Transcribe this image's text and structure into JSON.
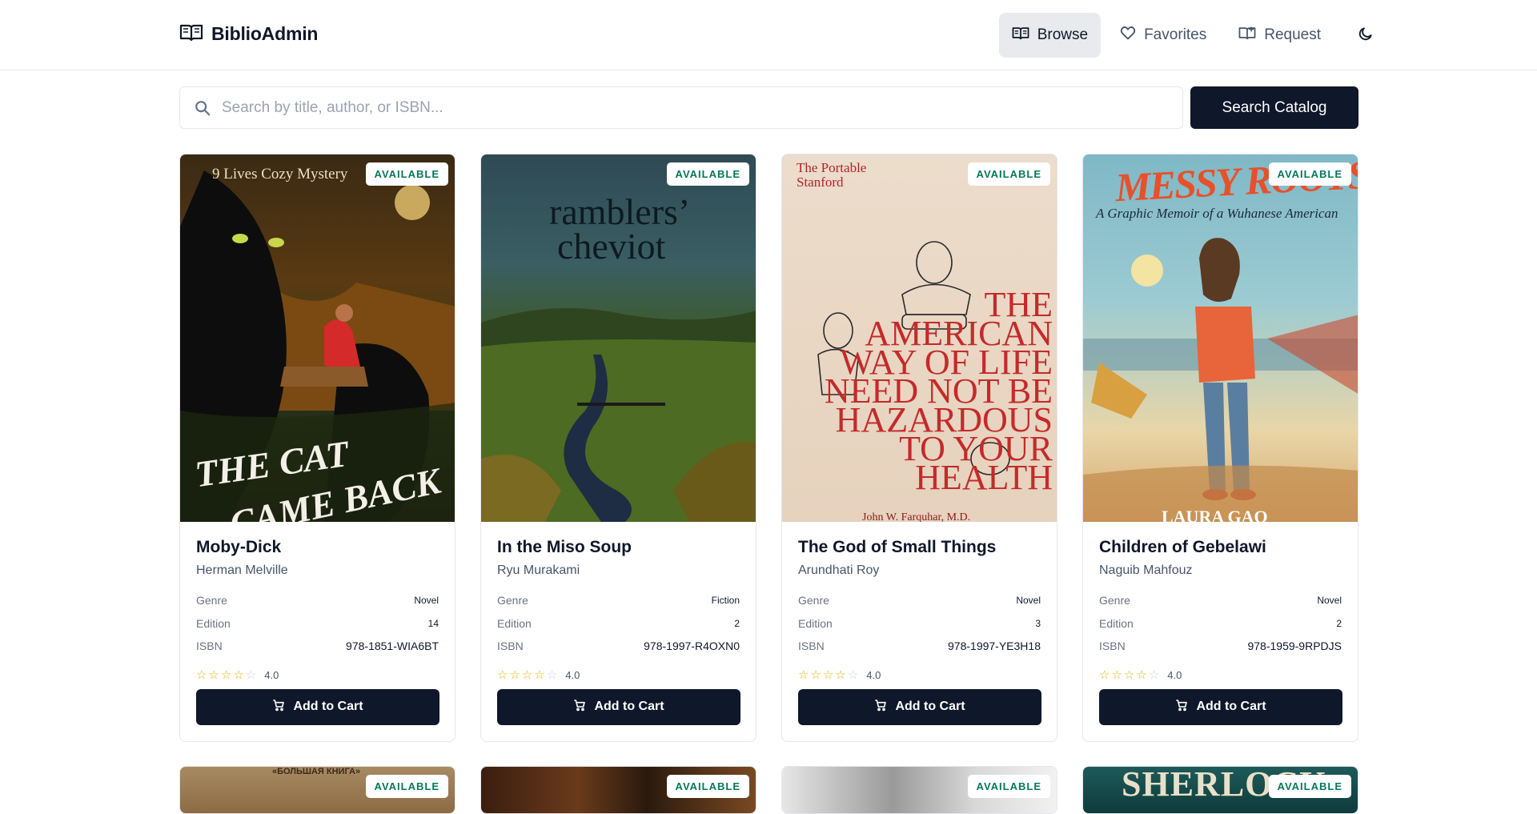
{
  "app": {
    "name": "BiblioAdmin"
  },
  "nav": {
    "browse": "Browse",
    "favorites": "Favorites",
    "request": "Request"
  },
  "search": {
    "placeholder": "Search by title, author, or ISBN...",
    "button": "Search Catalog"
  },
  "labels": {
    "genre": "Genre",
    "edition": "Edition",
    "isbn": "ISBN",
    "add_to_cart": "Add to Cart",
    "available": "AVAILABLE"
  },
  "books": [
    {
      "title": "Moby-Dick",
      "author": "Herman Melville",
      "genre": "Novel",
      "edition": "14",
      "isbn": "978-1851-WIA6BT",
      "rating": "4.0",
      "status": "AVAILABLE",
      "cover_text": [
        "9 Lives Cozy Mystery",
        "THE CAT",
        "CAME BACK"
      ]
    },
    {
      "title": "In the Miso Soup",
      "author": "Ryu Murakami",
      "genre": "Fiction",
      "edition": "2",
      "isbn": "978-1997-R4OXN0",
      "rating": "4.0",
      "status": "AVAILABLE",
      "cover_text": [
        "ramblers’",
        "cheviot"
      ]
    },
    {
      "title": "The God of Small Things",
      "author": "Arundhati Roy",
      "genre": "Novel",
      "edition": "3",
      "isbn": "978-1997-YE3H18",
      "rating": "4.0",
      "status": "AVAILABLE",
      "cover_text": [
        "The Portable Stanford",
        "THE AMERICAN WAY OF LIFE NEED NOT BE HAZARDOUS TO YOUR HEALTH",
        "John W. Farquhar, M.D."
      ]
    },
    {
      "title": "Children of Gebelawi",
      "author": "Naguib Mahfouz",
      "genre": "Novel",
      "edition": "2",
      "isbn": "978-1959-9RPDJS",
      "rating": "4.0",
      "status": "AVAILABLE",
      "cover_text": [
        "MESSY ROOTS",
        "A Graphic Memoir of a Wuhanese American",
        "LAURA GAO"
      ]
    }
  ],
  "second_row": [
    {
      "status": "AVAILABLE",
      "cover_text": [
        "«БОЛЬШАЯ КНИГА»"
      ]
    },
    {
      "status": "AVAILABLE",
      "cover_text": []
    },
    {
      "status": "AVAILABLE",
      "cover_text": []
    },
    {
      "status": "AVAILABLE",
      "cover_text": [
        "SHERLOCK"
      ]
    }
  ],
  "colors": {
    "primary": "#0f172a",
    "available": "#047857",
    "star": "#eab308"
  }
}
